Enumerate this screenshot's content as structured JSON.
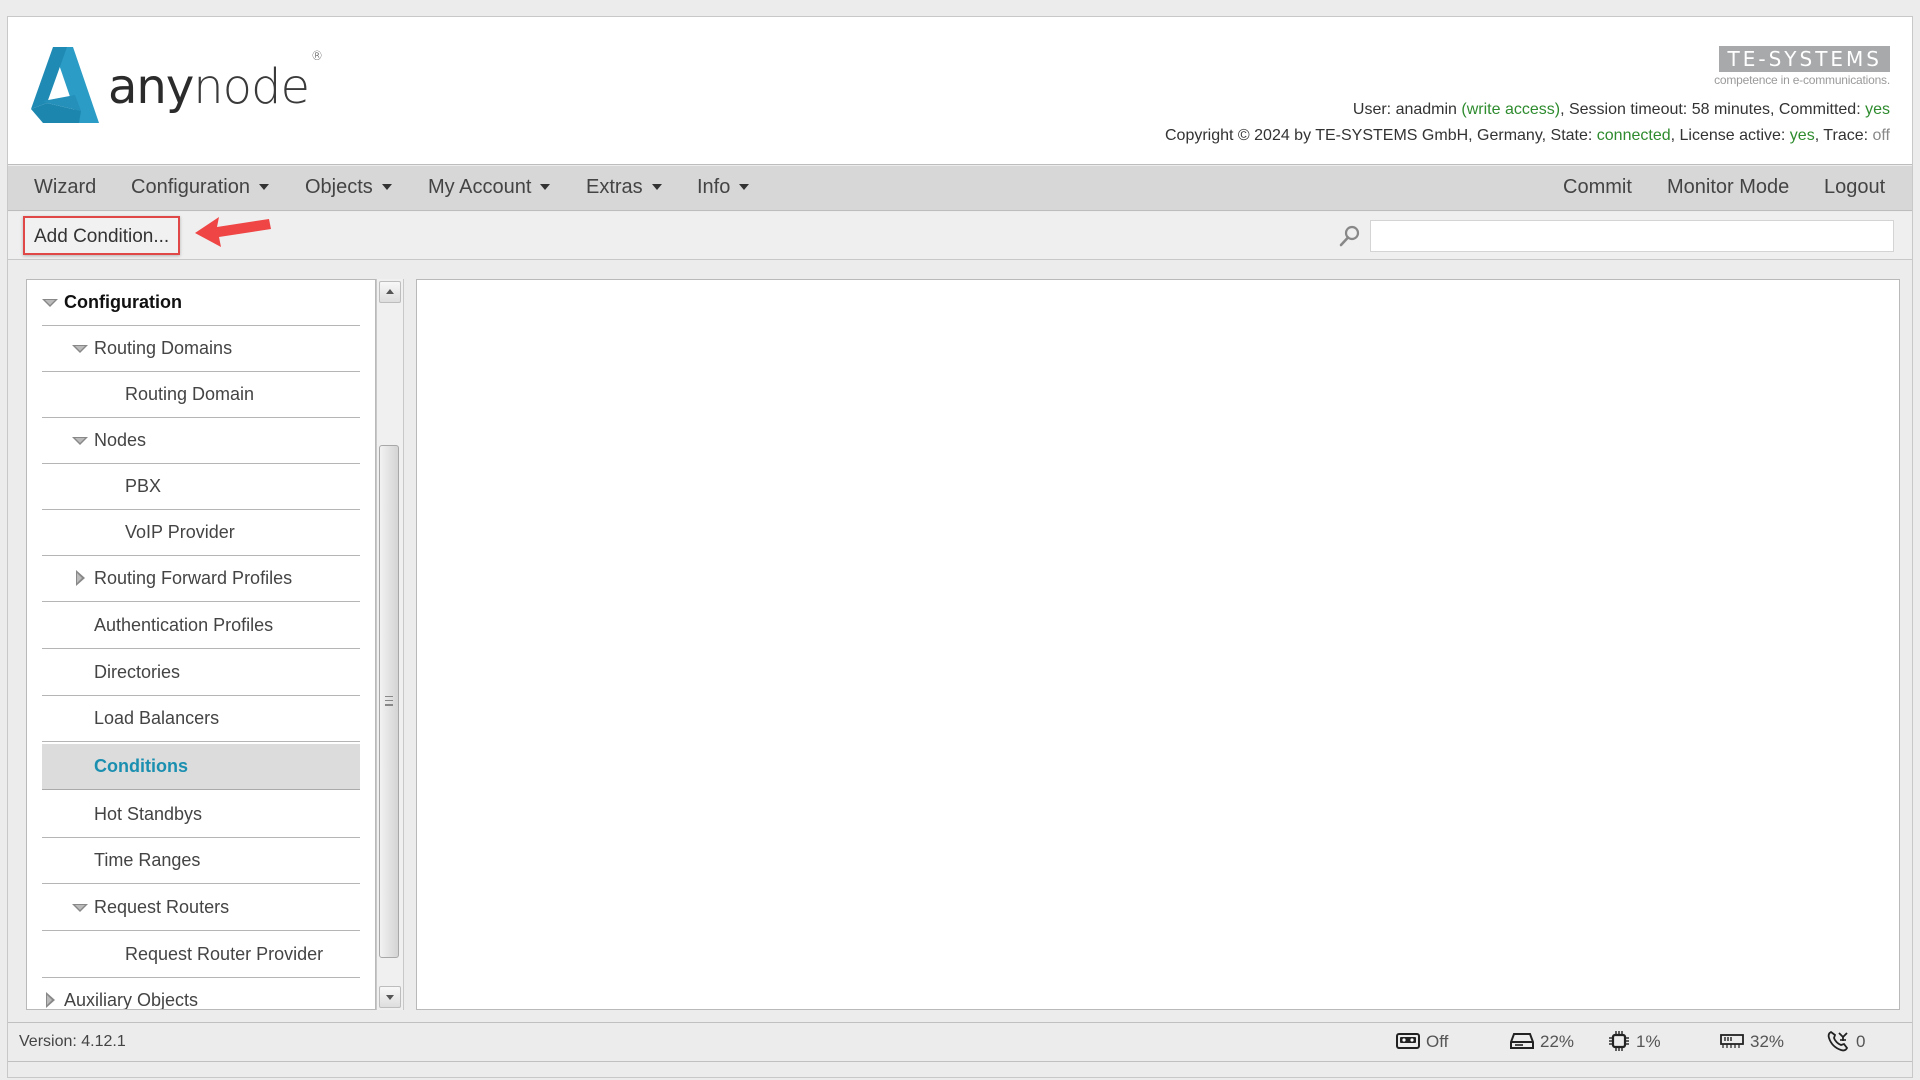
{
  "header": {
    "brand": {
      "strong": "any",
      "light": "node",
      "registered": "®"
    },
    "vendor_logo": {
      "name": "TE-SYSTEMS",
      "tagline": "competence in e-communications."
    },
    "status_line_1": {
      "user_label": "User: anadmin ",
      "access": "(write access)",
      "session": ", Session timeout: 58 minutes, Committed: ",
      "committed": "yes"
    },
    "status_line_2": {
      "copyright": "Copyright © 2024 by TE-SYSTEMS GmbH, Germany, State: ",
      "state": "connected",
      "license_label": ", License active: ",
      "license": "yes",
      "trace_label": ", Trace: ",
      "trace": "off"
    }
  },
  "nav": {
    "left": [
      {
        "label": "Wizard",
        "dropdown": false
      },
      {
        "label": "Configuration",
        "dropdown": true
      },
      {
        "label": "Objects",
        "dropdown": true
      },
      {
        "label": "My Account",
        "dropdown": true
      },
      {
        "label": "Extras",
        "dropdown": true
      },
      {
        "label": "Info",
        "dropdown": true
      }
    ],
    "right": [
      {
        "label": "Commit"
      },
      {
        "label": "Monitor Mode"
      },
      {
        "label": "Logout"
      }
    ]
  },
  "toolbar": {
    "add_button": "Add Condition...",
    "search": {
      "value": "",
      "placeholder": ""
    }
  },
  "tree": {
    "items": [
      {
        "label": "Configuration",
        "level": 0,
        "toggle": "expanded",
        "root": true
      },
      {
        "label": "Routing Domains",
        "level": 1,
        "toggle": "expanded"
      },
      {
        "label": "Routing Domain",
        "level": 2,
        "toggle": "none"
      },
      {
        "label": "Nodes",
        "level": 1,
        "toggle": "expanded"
      },
      {
        "label": "PBX",
        "level": 2,
        "toggle": "none"
      },
      {
        "label": "VoIP Provider",
        "level": 2,
        "toggle": "none"
      },
      {
        "label": "Routing Forward Profiles",
        "level": 1,
        "toggle": "collapsed"
      },
      {
        "label": "Authentication Profiles",
        "level": 1,
        "toggle": "none"
      },
      {
        "label": "Directories",
        "level": 1,
        "toggle": "none"
      },
      {
        "label": "Load Balancers",
        "level": 1,
        "toggle": "none"
      },
      {
        "label": "Conditions",
        "level": 1,
        "toggle": "none",
        "selected": true
      },
      {
        "label": "Hot Standbys",
        "level": 1,
        "toggle": "none"
      },
      {
        "label": "Time Ranges",
        "level": 1,
        "toggle": "none"
      },
      {
        "label": "Request Routers",
        "level": 1,
        "toggle": "expanded"
      },
      {
        "label": "Request Router Provider",
        "level": 2,
        "toggle": "none"
      },
      {
        "label": "Auxiliary Objects",
        "level": 0,
        "toggle": "collapsed"
      }
    ]
  },
  "statusbar": {
    "version": "Version: 4.12.1",
    "indicators": [
      {
        "icon": "recording-icon",
        "value": "Off"
      },
      {
        "icon": "disk-icon",
        "value": "22%"
      },
      {
        "icon": "cpu-icon",
        "value": "1%"
      },
      {
        "icon": "memory-icon",
        "value": "32%"
      },
      {
        "icon": "calls-icon",
        "value": "0"
      }
    ]
  },
  "colors": {
    "accent": "#1b8fb0",
    "logo_blue": "#2a9cc6",
    "ok_green": "#2e8b2e",
    "highlight_red": "#e04848"
  }
}
